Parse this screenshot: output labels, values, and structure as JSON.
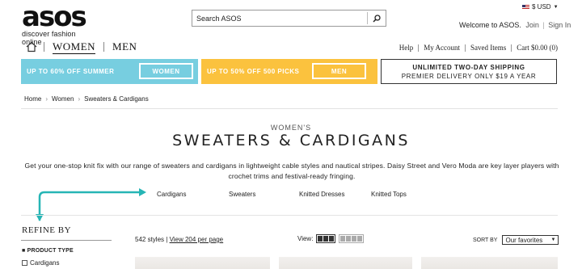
{
  "brand": {
    "logo": "asos",
    "tagline": "discover fashion online"
  },
  "search": {
    "placeholder": "Search ASOS"
  },
  "currency": {
    "label": "$ USD"
  },
  "account": {
    "welcome": "Welcome to ASOS.",
    "join": "Join",
    "sign_in": "Sign In"
  },
  "nav": {
    "women": "WOMEN",
    "men": "MEN"
  },
  "util_links": [
    "Help",
    "My Account",
    "Saved Items",
    "Cart $0.00 (0)"
  ],
  "banners": {
    "women": {
      "text": "UP TO 60% OFF SUMMER",
      "button": "WOMEN",
      "color": "#77cee0"
    },
    "men": {
      "text": "UP TO 50% OFF 500 PICKS",
      "button": "MEN",
      "color": "#fbc23e"
    },
    "shipping": {
      "line1": "UNLIMITED TWO-DAY SHIPPING",
      "line2": "PREMIER DELIVERY ONLY $19 A YEAR"
    }
  },
  "breadcrumb": [
    "Home",
    "Women",
    "Sweaters & Cardigans"
  ],
  "page": {
    "subtitle": "WOMEN'S",
    "title": "SWEATERS & CARDIGANS",
    "description": "Get your one-stop knit fix with our range of sweaters and cardigans in lightweight cable styles and nautical stripes. Daisy Street and Vero Moda are key layer players with crochet trims and festival-ready fringing."
  },
  "categories": [
    "Cardigans",
    "Sweaters",
    "Knitted Dresses",
    "Knitted Tops"
  ],
  "refine": {
    "heading": "REFINE BY",
    "product_type": "PRODUCT TYPE",
    "options": [
      "Cardigans"
    ]
  },
  "listing": {
    "count": "542 styles",
    "sep": " | ",
    "view_all": "View 204 per page",
    "view_label": "View:",
    "sort_label": "SORT BY",
    "sort_value": "Our favorites"
  },
  "colors": {
    "accent_teal": "#26b5b5"
  }
}
